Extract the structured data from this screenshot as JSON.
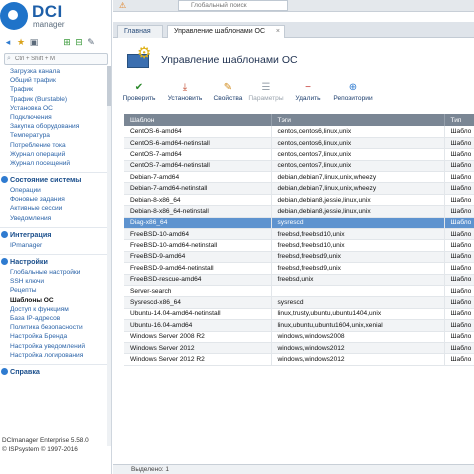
{
  "logo": {
    "brand": "DCI",
    "product": "manager"
  },
  "sidebar": {
    "search_placeholder": "Ctrl + Shift + M",
    "items_top": [
      "Загрузка канала",
      "Общий трафик",
      "Трафик",
      "Трафик (Burstable)",
      "Установка ОС",
      "Подключения",
      "Закупка оборудования",
      "Температура",
      "Потребление тока",
      "Журнал операций",
      "Журнал посещений"
    ],
    "sections": [
      {
        "title": "Состояние системы",
        "items": [
          "Операции",
          "Фоновые задания",
          "Активные сессии",
          "Уведомления"
        ]
      },
      {
        "title": "Интеграция",
        "items": [
          "IPmanager"
        ]
      },
      {
        "title": "Настройки",
        "items": [
          "Глобальные настройки",
          "SSH ключи",
          "Рецепты",
          "Шаблоны ОС",
          "Доступ к функциям",
          "База IP-адресов",
          "Политика безопасности",
          "Настройка Бренда",
          "Настройка уведомлений",
          "Настройка логирования"
        ]
      },
      {
        "title": "Справка",
        "items": []
      }
    ],
    "footer": [
      "DCImanager Enterprise 5.58.0",
      "© ISPsystem © 1997-2016"
    ]
  },
  "topbar": {
    "search_placeholder": "Глобальный поиск"
  },
  "tabs": [
    {
      "label": "Главная"
    },
    {
      "label": "Управление шаблонами ОС",
      "close": "×"
    }
  ],
  "page": {
    "title": "Управление шаблонами ОС"
  },
  "actions": [
    {
      "label": "Проверить",
      "icon": "check-icon"
    },
    {
      "label": "Установить",
      "icon": "install-icon"
    },
    {
      "label": "Свойства",
      "icon": "properties-icon"
    },
    {
      "label": "Параметры",
      "icon": "params-icon"
    },
    {
      "label": "Удалить",
      "icon": "delete-icon"
    },
    {
      "label": "Репозитории",
      "icon": "repo-icon"
    }
  ],
  "table": {
    "headers": [
      "Шаблон",
      "Тэги",
      "Тип"
    ],
    "rows": [
      [
        "CentOS-6-amd64",
        "centos,centos6,linux,unix",
        "Шабло"
      ],
      [
        "CentOS-6-amd64-netinstall",
        "centos,centos6,linux,unix",
        "Шабло"
      ],
      [
        "CentOS-7-amd64",
        "centos,centos7,linux,unix",
        "Шабло"
      ],
      [
        "CentOS-7-amd64-netinstall",
        "centos,centos7,linux,unix",
        "Шабло"
      ],
      [
        "Debian-7-amd64",
        "debian,debian7,linux,unix,wheezy",
        "Шабло"
      ],
      [
        "Debian-7-amd64-netinstall",
        "debian,debian7,linux,unix,wheezy",
        "Шабло"
      ],
      [
        "Debian-8-x86_64",
        "debian,debian8,jessie,linux,unix",
        "Шабло"
      ],
      [
        "Debian-8-x86_64-netinstall",
        "debian,debian8,jessie,linux,unix",
        "Шабло"
      ],
      [
        "Diag-x86_64",
        "sysrescd",
        "Шабло"
      ],
      [
        "FreeBSD-10-amd64",
        "freebsd,freebsd10,unix",
        "Шабло"
      ],
      [
        "FreeBSD-10-amd64-netinstall",
        "freebsd,freebsd10,unix",
        "Шабло"
      ],
      [
        "FreeBSD-9-amd64",
        "freebsd,freebsd9,unix",
        "Шабло"
      ],
      [
        "FreeBSD-9-amd64-netinstall",
        "freebsd,freebsd9,unix",
        "Шабло"
      ],
      [
        "FreeBSD-rescue-amd64",
        "freebsd,unix",
        "Шабло"
      ],
      [
        "Server-search",
        "",
        "Шабло"
      ],
      [
        "Sysrescd-x86_64",
        "sysrescd",
        "Шабло"
      ],
      [
        "Ubuntu-14.04-amd64-netinstall",
        "linux,trusty,ubuntu,ubuntu1404,unix",
        "Шабло"
      ],
      [
        "Ubuntu-16.04-amd64",
        "linux,ubuntu,ubuntu1604,unix,xenial",
        "Шабло"
      ],
      [
        "Windows Server 2008 R2",
        "windows,windows2008",
        "Шабло"
      ],
      [
        "Windows Server 2012",
        "windows,windows2012",
        "Шабло"
      ],
      [
        "Windows Server 2012 R2",
        "windows,windows2012",
        "Шабло"
      ]
    ],
    "selected_index": 8
  },
  "status": {
    "text": "Выделено: 1"
  },
  "colors": {
    "accent": "#1f73c9",
    "selected_row": "#5e93cf",
    "header": "#7a8694"
  }
}
